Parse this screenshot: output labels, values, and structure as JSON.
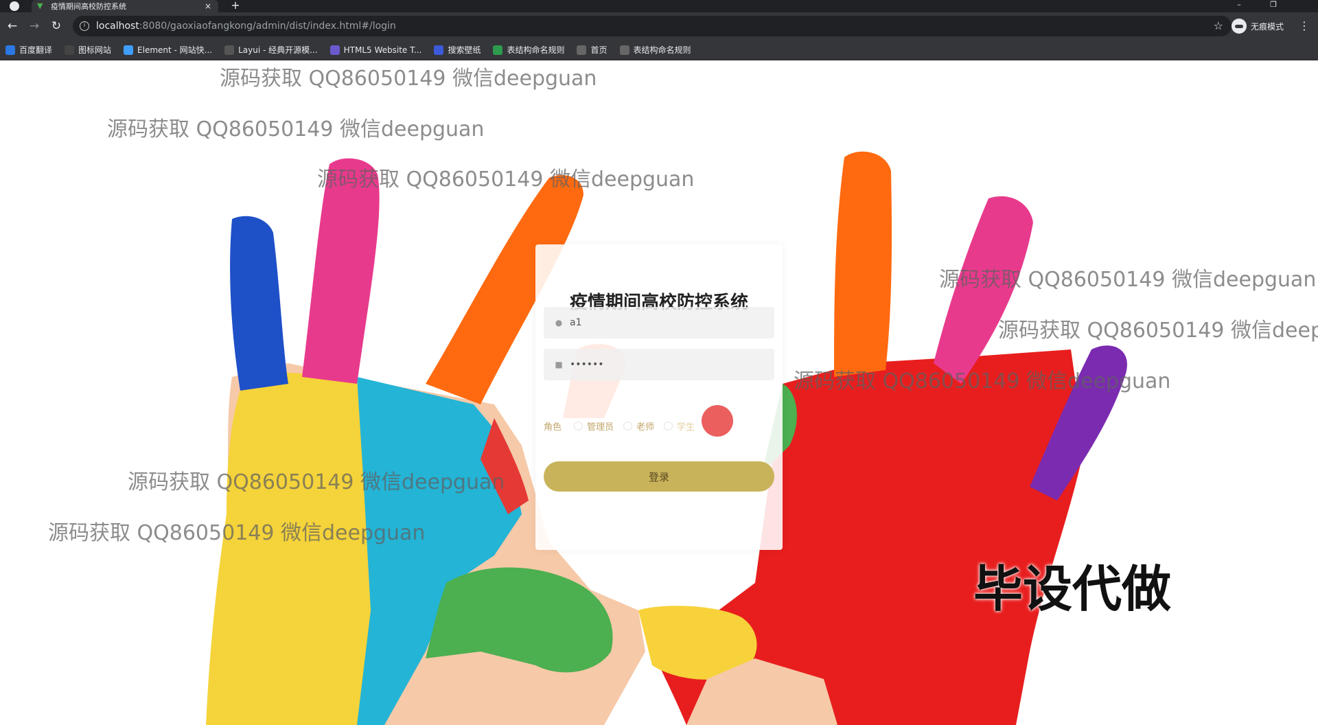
{
  "browser": {
    "tab_title": "疫情期间高校防控系统",
    "tab_close": "×",
    "new_tab": "+",
    "url_host": "localhost",
    "url_rest": ":8080/gaoxiaofangkong/admin/dist/index.html#/login",
    "incognito_label": "无痕模式",
    "star": "☆",
    "menu": "⋮"
  },
  "bookmarks": [
    {
      "label": "百度翻译",
      "color": "#2b78e4",
      "icon": "translate-icon"
    },
    {
      "label": "图标网站",
      "color": "#444444",
      "icon": "flag-icon"
    },
    {
      "label": "Element - 网站快...",
      "color": "#409eff",
      "icon": "element-icon"
    },
    {
      "label": "Layui - 经典开源模...",
      "color": "#555555",
      "icon": "layui-icon"
    },
    {
      "label": "HTML5 Website T...",
      "color": "#6a5acd",
      "icon": "html5-icon"
    },
    {
      "label": "搜索壁纸",
      "color": "#3b5bdb",
      "icon": "wallpaper-icon"
    },
    {
      "label": "表结构命名规则",
      "color": "#2e9b4e",
      "icon": "sheet-icon"
    },
    {
      "label": "首页",
      "color": "#666666",
      "icon": "globe-icon"
    },
    {
      "label": "表结构命名规则",
      "color": "#666666",
      "icon": "globe-icon"
    }
  ],
  "login": {
    "title": "疫情期间高校防控系统",
    "username_value": "a1",
    "password_value": "••••••",
    "role_label": "角色",
    "roles": [
      "管理员",
      "老师",
      "学生"
    ],
    "submit_label": "登录"
  },
  "watermark": {
    "text": "源码获取 QQ86050149 微信deepguan",
    "text_cut": "源码获取 QQ86050149 微信deep"
  },
  "overlay_text": "毕设代做"
}
